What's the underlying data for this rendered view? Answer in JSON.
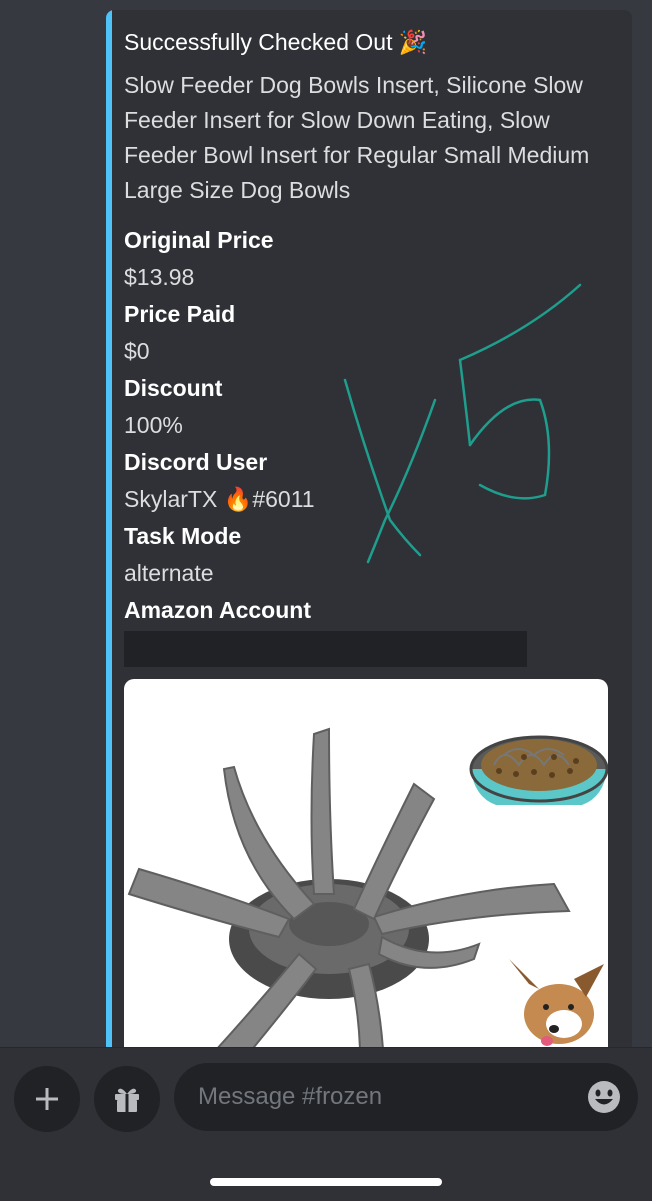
{
  "embed": {
    "title": "Successfully Checked Out 🎉",
    "description": "Slow Feeder Dog Bowls Insert, Silicone Slow Feeder Insert for Slow Down Eating, Slow Feeder Bowl Insert for Regular Small Medium Large Size Dog Bowls",
    "fields": [
      {
        "name": "Original Price",
        "value": "$13.98"
      },
      {
        "name": "Price Paid",
        "value": "$0"
      },
      {
        "name": "Discount",
        "value": "100%"
      },
      {
        "name": "Discord User",
        "value": "SkylarTX 🔥#6011"
      },
      {
        "name": "Task Mode",
        "value": "alternate"
      },
      {
        "name": "Amazon Account",
        "value": ""
      }
    ],
    "accent_color": "#4fc3f7"
  },
  "composer": {
    "placeholder": "Message #frozen",
    "add_icon": "plus-icon",
    "gift_icon": "gift-icon",
    "emoji_icon": "emoji-icon"
  },
  "annotation": {
    "handwritten_text": "X5"
  }
}
